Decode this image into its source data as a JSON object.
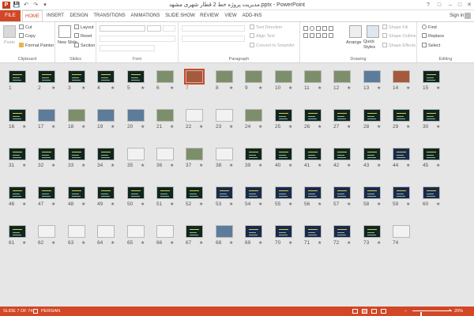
{
  "app": {
    "title": "مدیریت پروژه خط 2 قطار شهری مشهد.pptx - PowerPoint",
    "logo_letter": "P",
    "accent": "#d24726"
  },
  "qat": {
    "save": "💾",
    "undo": "↶",
    "redo": "↷",
    "more": "▾"
  },
  "window": {
    "help": "?",
    "restore": "□",
    "minimize": "–",
    "maximize": "□",
    "close": "✕"
  },
  "tabs": {
    "file": "FILE",
    "items": [
      "HOME",
      "INSERT",
      "DESIGN",
      "TRANSITIONS",
      "ANIMATIONS",
      "SLIDE SHOW",
      "REVIEW",
      "VIEW",
      "ADD-INS"
    ],
    "active": "HOME"
  },
  "account": {
    "signin": "Sign in"
  },
  "ribbon": {
    "clipboard": {
      "label": "Clipboard",
      "paste": "Paste",
      "cut": "Cut",
      "copy": "Copy",
      "format_painter": "Format Painter"
    },
    "slides": {
      "label": "Slides",
      "new_slide": "New Slide",
      "layout": "Layout",
      "reset": "Reset",
      "section": "Section"
    },
    "font": {
      "label": "Font"
    },
    "paragraph": {
      "label": "Paragraph",
      "text_direction": "Text Direction",
      "align_text": "Align Text",
      "convert_smartart": "Convert to SmartArt"
    },
    "drawing": {
      "label": "Drawing",
      "arrange": "Arrange",
      "quick_styles": "Quick Styles",
      "shape_fill": "Shape Fill",
      "shape_outline": "Shape Outline",
      "shape_effects": "Shape Effects"
    },
    "editing": {
      "label": "Editing",
      "find": "Find",
      "replace": "Replace",
      "select": "Select"
    }
  },
  "sorter": {
    "total": 74,
    "selected": 7,
    "star": "★"
  },
  "status": {
    "slide_info": "SLIDE 7 OF 74",
    "language": "PERSIAN",
    "zoom_minus": "–",
    "zoom_plus": "+",
    "zoom": "20%",
    "zoom_fraction": 0.2
  }
}
